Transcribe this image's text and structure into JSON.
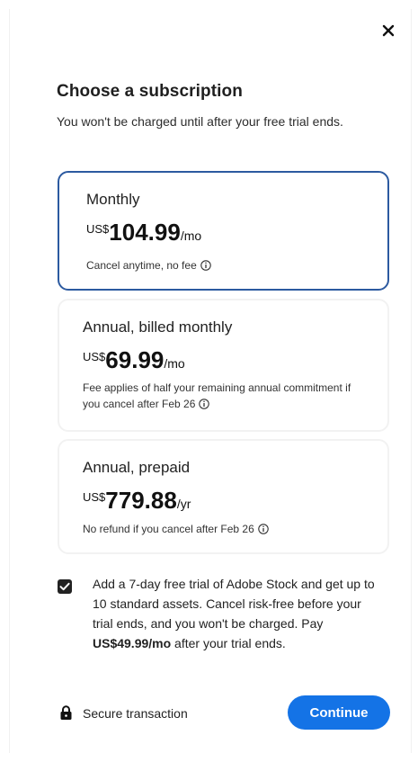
{
  "dialog": {
    "title": "Choose a subscription",
    "subtitle": "You won't be charged until after your free trial ends."
  },
  "plans": [
    {
      "name": "Monthly",
      "currency": "US$",
      "amount": "104.99",
      "period": "/mo",
      "note": "Cancel anytime, no fee",
      "selected": true
    },
    {
      "name": "Annual, billed monthly",
      "currency": "US$",
      "amount": "69.99",
      "period": "/mo",
      "note": "Fee applies of half your remaining annual commitment if you cancel after Feb 26",
      "selected": false
    },
    {
      "name": "Annual, prepaid",
      "currency": "US$",
      "amount": "779.88",
      "period": "/yr",
      "note": "No refund if you cancel after Feb 26",
      "selected": false
    }
  ],
  "addon": {
    "checked": true,
    "text_before": "Add a 7-day free trial of Adobe Stock and get up to 10 standard assets. Cancel risk-free before your trial ends, and you won't be charged. Pay ",
    "price": "US$49.99/mo",
    "text_after": " after your trial ends."
  },
  "footer": {
    "secure_label": "Secure transaction",
    "continue_label": "Continue"
  },
  "icons": {
    "close": "close-icon",
    "info": "info-icon",
    "lock": "lock-icon",
    "check": "checkmark-icon"
  },
  "colors": {
    "accent": "#1473e6",
    "selected_border": "#2c5aa0",
    "checkbox": "#222222"
  }
}
